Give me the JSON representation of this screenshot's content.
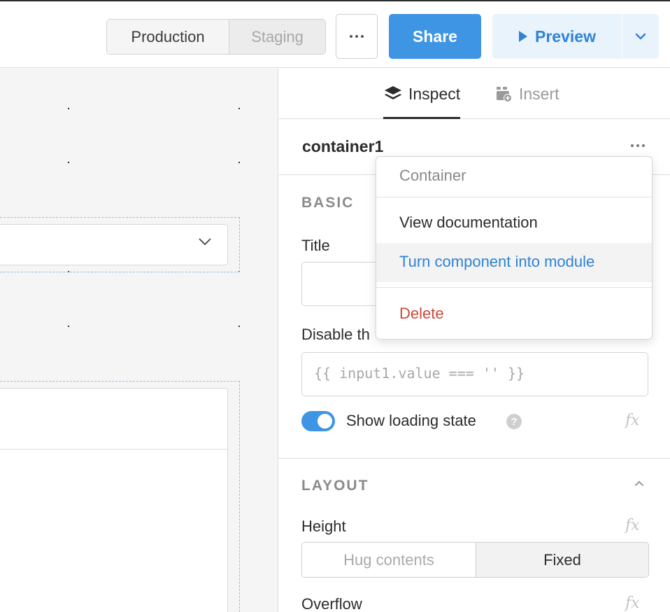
{
  "topbar": {
    "env": {
      "production": "Production",
      "staging": "Staging"
    },
    "share_label": "Share",
    "preview_label": "Preview",
    "colors": {
      "share_bg": "#3d95e4",
      "preview_bg": "#e9f3fc",
      "preview_text": "#2f83d6"
    }
  },
  "panel": {
    "tabs": [
      {
        "label": "Inspect",
        "icon": "layers-icon",
        "active": true
      },
      {
        "label": "Insert",
        "icon": "insert-component-icon",
        "active": false
      }
    ],
    "component_name": "container1",
    "basic": {
      "section_title": "BASIC",
      "title_label": "Title",
      "title_value": "",
      "disable_label": "Disable th",
      "disable_value": "{{ input1.value === '' }}",
      "show_loading_label": "Show loading state",
      "show_loading_on": true,
      "fx": "fx"
    },
    "layout": {
      "section_title": "LAYOUT",
      "height_label": "Height",
      "height_options": [
        "Hug contents",
        "Fixed"
      ],
      "height_selected": "Fixed",
      "overflow_label": "Overflow"
    }
  },
  "menu": {
    "header": "Container",
    "items": [
      "View documentation",
      "Turn component into module",
      "Delete"
    ],
    "colors": {
      "highlight": "#2f83d6",
      "danger": "#cc4a3c"
    }
  }
}
